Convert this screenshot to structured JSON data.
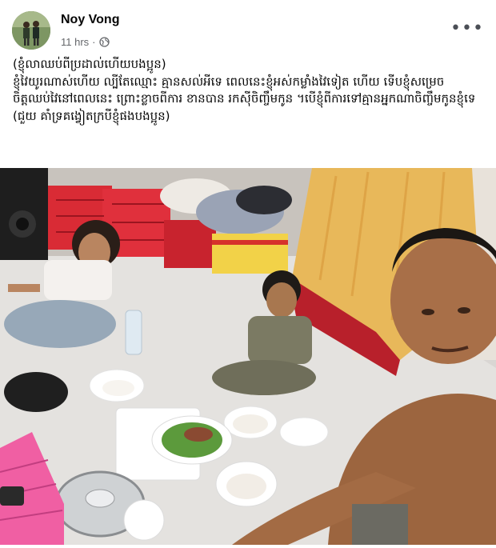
{
  "post": {
    "author": "Noy Vong",
    "time": "11 hrs",
    "separator": "·",
    "privacy_icon": "globe-icon",
    "more_icon": "more-horizontal-icon",
    "text": "(ខ្ញុំលាឈប់ពីប្រដាល់ហើយបងប្អូន)\nខ្ញុំវៃយូរណាស់ហើយ ល្បីតែឈ្មោះ គ្មានសល់អីទេ ពេលនេះខ្ញុំអស់កម្លាំងវៃទៀត ហើយ ទើបខ្ញុំសម្រេចចិត្តឈប់វៃនៅពេលនេះ ព្រោះខ្លាចពីការ ខានបាន រកស៊ីចិញ្ចឹមកូន ។បើខ្ញុំពីការទៅគ្មានអ្នកណាចិញ្ចឹមកូនខ្ញុំទេ (ជួយ គាំទ្រគង្វៀតក្របីខ្ញុំផងបងប្អូន)"
  },
  "colors": {
    "secondary_text": "#65676b",
    "primary_text": "#050505"
  }
}
